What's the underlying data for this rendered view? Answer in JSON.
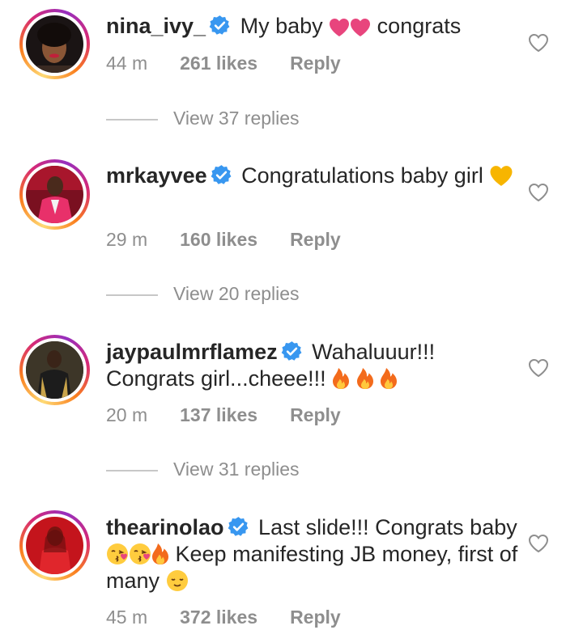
{
  "comments": [
    {
      "username": "nina_ivy_",
      "text_parts": [
        "My baby",
        "congrats"
      ],
      "emojis": [
        "pink-heart-emoji",
        "pink-heart-emoji"
      ],
      "time": "44 m",
      "likes": "261 likes",
      "reply_label": "Reply",
      "view_replies": "View 37 replies"
    },
    {
      "username": "mrkayvee",
      "text_parts": [
        "Congratulations baby girl"
      ],
      "emojis": [
        "yellow-heart-emoji"
      ],
      "time": "29 m",
      "likes": "160 likes",
      "reply_label": "Reply",
      "view_replies": "View 20 replies"
    },
    {
      "username": "jaypaulmrflamez",
      "text_parts": [
        "Wahaluuur!!!",
        "Congrats girl...cheee!!!"
      ],
      "emojis": [
        "fire-emoji",
        "fire-emoji",
        "fire-emoji"
      ],
      "time": "20 m",
      "likes": "137 likes",
      "reply_label": "Reply",
      "view_replies": "View 31 replies"
    },
    {
      "username": "thearinolao",
      "text_parts": [
        "Last slide!!! Congrats baby",
        "Keep manifesting JB money, first of many"
      ],
      "emojis": [
        "kissing-face-emoji",
        "kissing-face-emoji",
        "fire-emoji",
        "relieved-face-emoji"
      ],
      "time": "45 m",
      "likes": "372 likes",
      "reply_label": "Reply"
    }
  ],
  "colors": {
    "text": "#262626",
    "secondary": "#8e8e8e",
    "verified": "#3897f0",
    "pink_heart": "#e8457d",
    "yellow_heart": "#f7b500"
  }
}
